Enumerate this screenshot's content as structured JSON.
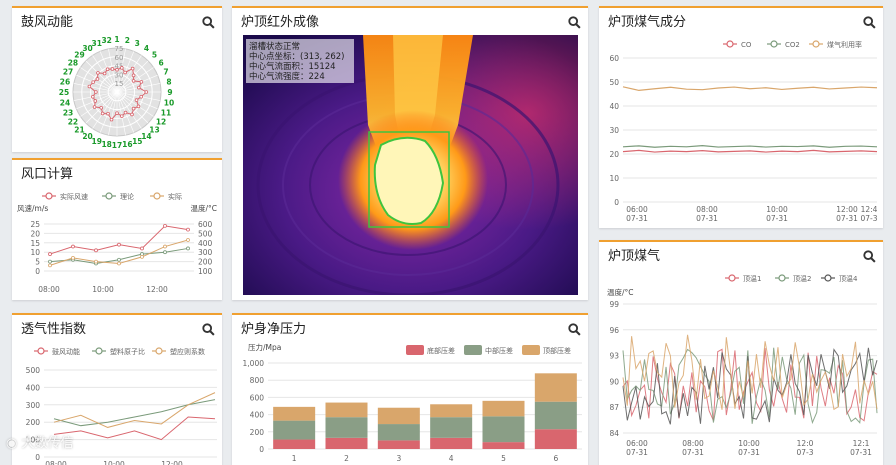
{
  "colors": {
    "accent": "#f0a030",
    "red": "#d9666e",
    "green": "#7a9a7a",
    "tan": "#d9a66b",
    "dark": "#555555"
  },
  "panels": {
    "blower": {
      "title": "鼓风动能"
    },
    "tuyere": {
      "title": "风口计算"
    },
    "perm": {
      "title": "透气性指数"
    },
    "ir": {
      "title": "炉顶红外成像"
    },
    "body_pressure": {
      "title": "炉身净压力"
    },
    "gas_comp": {
      "title": "炉顶煤气成分"
    },
    "gas_temp": {
      "title": "炉顶煤气"
    }
  },
  "ir_overlay": {
    "line1": "溜槽状态正常",
    "line2": "中心点坐标：(313, 262)",
    "line3": "中心气流面积：15124",
    "line4": "中心气流强度：224"
  },
  "watermark": "大数传信",
  "charts": {
    "radar": {
      "type": "radar",
      "labels": [
        "1",
        "2",
        "3",
        "4",
        "5",
        "6",
        "7",
        "8",
        "9",
        "10",
        "11",
        "12",
        "13",
        "14",
        "15",
        "16",
        "17",
        "18",
        "19",
        "20",
        "21",
        "22",
        "23",
        "24",
        "25",
        "26",
        "27",
        "28",
        "29",
        "30",
        "31",
        "32"
      ],
      "ticks": [
        "15",
        "30",
        "45",
        "60",
        "75"
      ],
      "rmax": 75,
      "series": [
        {
          "values": [
            38,
            42,
            36,
            48,
            40,
            34,
            45,
            38,
            50,
            42,
            36,
            44,
            40,
            46,
            38,
            42,
            36,
            48,
            40,
            44,
            38,
            46,
            40,
            42,
            36,
            48,
            44,
            40,
            46,
            38,
            42,
            40
          ]
        }
      ]
    },
    "tuyere": {
      "type": "line",
      "legend": [
        "实际风速",
        "理论",
        "实际"
      ],
      "ylabel_left": "风速/m/s",
      "ylabel_right": "温度/°C",
      "xticks": [
        "08:00",
        "10:00",
        "12:00"
      ],
      "yticks_left": [
        "0",
        "5",
        "10",
        "15",
        "20",
        "25"
      ],
      "yticks_right": [
        "100",
        "200",
        "300",
        "400",
        "500",
        "600"
      ],
      "y_left_range": [
        0,
        25
      ],
      "y_right_range": [
        100,
        600
      ],
      "series": [
        {
          "values": [
            9,
            13,
            11,
            14,
            12,
            24,
            22
          ],
          "axis": "left"
        },
        {
          "values": [
            5,
            6,
            4,
            6,
            9,
            10,
            12
          ],
          "axis": "left"
        },
        {
          "values": [
            160,
            240,
            200,
            180,
            250,
            360,
            430
          ],
          "axis": "right"
        }
      ]
    },
    "perm": {
      "type": "line",
      "legend": [
        "鼓风动能",
        "塑料原子比",
        "塑应则系数"
      ],
      "xticks": [
        "08:00",
        "10:00",
        "12:00"
      ],
      "yticks": [
        "0",
        "100",
        "200",
        "300",
        "400",
        "500"
      ],
      "ylim": [
        0,
        500
      ],
      "series": [
        {
          "values": [
            130,
            150,
            110,
            150,
            100,
            230,
            220
          ]
        },
        {
          "values": [
            220,
            180,
            200,
            230,
            260,
            300,
            330
          ]
        },
        {
          "values": [
            200,
            240,
            170,
            210,
            190,
            300,
            370
          ]
        }
      ]
    },
    "body_pressure": {
      "type": "stacked-bar",
      "ylabel": "压力/Mpa",
      "legend": [
        "底部压差",
        "中部压差",
        "顶部压差"
      ],
      "categories": [
        "1",
        "2",
        "3",
        "4",
        "5",
        "6"
      ],
      "yticks": [
        "0",
        "200",
        "400",
        "600",
        "800",
        "1,000"
      ],
      "ylim": [
        0,
        1000
      ],
      "series": [
        {
          "values": [
            110,
            130,
            100,
            130,
            80,
            230
          ]
        },
        {
          "values": [
            220,
            240,
            190,
            240,
            300,
            320
          ]
        },
        {
          "values": [
            160,
            170,
            190,
            150,
            180,
            330
          ]
        }
      ]
    },
    "gas_comp": {
      "type": "line",
      "legend": [
        "CO",
        "CO2",
        "煤气利用率"
      ],
      "xticks": [
        [
          "06:00",
          "07-31"
        ],
        [
          "08:00",
          "07-31"
        ],
        [
          "10:00",
          "07-31"
        ],
        [
          "12:00",
          "07-31"
        ],
        [
          "12:4",
          "07-3"
        ]
      ],
      "yticks": [
        "0",
        "10",
        "20",
        "30",
        "40",
        "50",
        "60"
      ],
      "ylim": [
        0,
        60
      ],
      "series": [
        {
          "values": [
            21,
            21.5,
            20.8,
            21.2,
            21,
            21.4,
            20.9,
            21.1,
            21.3,
            20.8,
            21.2,
            21,
            21.5,
            20.9,
            21.1,
            21.3,
            21
          ]
        },
        {
          "values": [
            23,
            23.4,
            22.8,
            23.2,
            23,
            23.5,
            22.9,
            23.1,
            23.3,
            22.9,
            23.2,
            23.1,
            23.4,
            22.8,
            23.2,
            23.3,
            23
          ]
        },
        {
          "values": [
            48,
            46.5,
            47.2,
            47.8,
            47,
            46.8,
            47.5,
            47.9,
            47.2,
            47.6,
            46.9,
            47.4,
            47.8,
            47.1,
            47.5,
            47.9,
            47.6
          ]
        }
      ]
    },
    "gas_temp": {
      "type": "line",
      "legend": [
        "顶温1",
        "顶温2",
        "顶温4"
      ],
      "ylabel": "温度/°C",
      "xticks": [
        [
          "06:00",
          "07-31"
        ],
        [
          "08:00",
          "07-31"
        ],
        [
          "10:00",
          "07-31"
        ],
        [
          "12:0",
          "07-3"
        ],
        [
          "12:1",
          "07-31"
        ]
      ],
      "yticks": [
        "84",
        "87",
        "90",
        "93",
        "96",
        "99"
      ],
      "ylim": [
        84,
        99
      ]
    }
  }
}
